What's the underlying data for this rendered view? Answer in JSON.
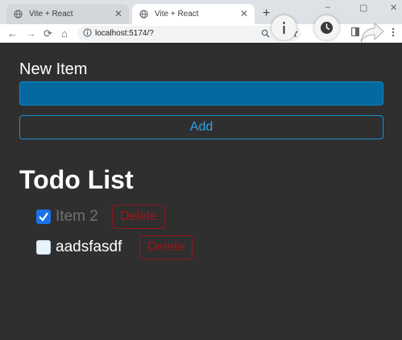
{
  "browser": {
    "tabs": [
      {
        "title": "Vite + React",
        "close": "✕",
        "active": false
      },
      {
        "title": "Vite + React",
        "close": "✕",
        "active": true
      }
    ],
    "new_tab": "+",
    "window_controls": {
      "minimize": "–",
      "maximize": "▢",
      "close": "✕"
    },
    "nav": {
      "back": "←",
      "forward": "→",
      "reload": "⟳",
      "home": "⌂"
    },
    "url": "localhost:5174/?"
  },
  "app": {
    "new_item_label": "New Item",
    "input_value": "",
    "add_button": "Add",
    "list_title": "Todo List",
    "todos": [
      {
        "text": "Item 2",
        "completed": true,
        "delete_label": "Delete"
      },
      {
        "text": "aadsfasdf",
        "completed": false,
        "delete_label": "Delete"
      }
    ]
  },
  "colors": {
    "page_background": "#2f2f2f",
    "input_fill": "#04699e",
    "accent_blue": "#2ea5e8",
    "delete_red": "#a3141b",
    "completed_text": "#6c7278"
  }
}
